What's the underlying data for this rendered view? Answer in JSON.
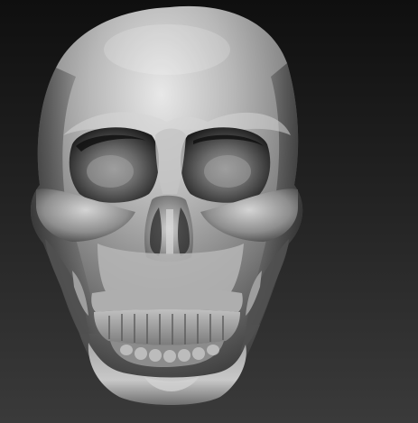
{
  "scene": {
    "subject": "skull-sculpt",
    "colors": {
      "background_top": "#0f0f0f",
      "background_bottom": "#3a3a3a",
      "material_base": "#9a9a9a",
      "material_highlight": "#e6e6e6",
      "material_shadow": "#2a2a2a"
    }
  }
}
